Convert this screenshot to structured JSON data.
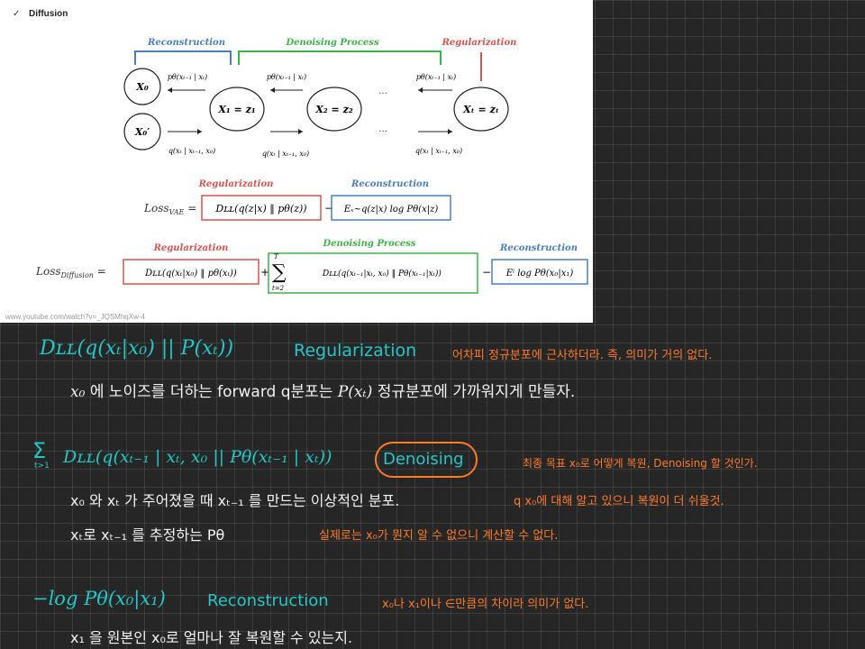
{
  "slide": {
    "header": "Diffusion",
    "check": "✓",
    "url": "www.youtube.com/watch?v=_JQSMhqXw-4",
    "labels": {
      "reconstruction": "Reconstruction",
      "denoising_process": "Denoising Process",
      "regularization": "Regularization"
    },
    "nodes": {
      "x0": "X₀",
      "x0_prime": "X₀′",
      "x1": "X₁ = z₁",
      "x2": "X₂ = z₂",
      "xT": "Xₜ = zₜ"
    },
    "arrows": {
      "p_x0": "pθ(xₜ₋₁ | xₜ)",
      "p_x1": "pθ(xₜ₋₁ | xₜ)",
      "p_xT": "pθ(xₜ₋₁ | xₜ)",
      "q_x0": "q(xₜ | xₜ₋₁, x₀)",
      "q_x1": "q(xₜ | xₜ₋₁, x₀)",
      "q_xT": "q(xₜ | xₜ₋₁, x₀)",
      "dots": "…"
    },
    "vae": {
      "loss": "Loss",
      "loss_sub": "VAE",
      "reg_label": "Regularization",
      "rec_label": "Reconstruction",
      "reg_term": "Dʟʟ(q(z|x) ‖ pθ(z))",
      "rec_term": "Eₓ~q(z|x) log Pθ(x|z)"
    },
    "diff": {
      "loss": "Loss",
      "loss_sub": "Diffusion",
      "reg_label": "Regularization",
      "den_label": "Denoising Process",
      "rec_label": "Reconstruction",
      "reg_term": "Dʟʟ(q(xₜ|x₀) ‖ pθ(xₜ))",
      "sum_top": "T",
      "sum_bottom": "t=2",
      "den_term": "Dʟʟ(q(xₜ₋₁|xₜ, x₀) ‖ Pθ(xₜ₋₁|xₜ))",
      "rec_term": "Eⁱ log Pθ(x₀|x₁)"
    }
  },
  "notes": {
    "line1": {
      "formula": "Dʟʟ(q(xₜ|x₀) || P(xₜ))",
      "tag": "Regularization",
      "comment": "어차피 정규분포에 근사하더라. 즉, 의미가 거의 없다."
    },
    "line2": {
      "var": "x₀",
      "text_a": "에 노이즈를 더하는 forward q분포는",
      "formula": "P(xₜ)",
      "text_b": "정규분포에 가까워지게 만들자."
    },
    "line3": {
      "sum": "Σ",
      "sum_sub": "t>1",
      "formula": "Dʟʟ(q(xₜ₋₁ | xₜ, x₀ || Pθ(xₜ₋₁ | xₜ))",
      "tag": "Denoising",
      "comment": "최종 목표 x₀로 어떻게 복원, Denoising 할 것인가."
    },
    "line4": {
      "text": "x₀ 와 xₜ 가 주어졌을 때 xₜ₋₁ 를 만드는 이상적인 분포.",
      "comment": "q x₀에 대해 알고 있으니 복원이 더 쉬울것."
    },
    "line5": {
      "text": "xₜ로 xₜ₋₁ 를 추정하는 Pθ",
      "comment": "실제로는 x₀가 뭔지 알 수 없으니 계산할 수 없다."
    },
    "line6": {
      "formula": "−log Pθ(x₀|x₁)",
      "tag": "Reconstruction",
      "comment": "x₀나 x₁이나 ∈만큼의 차이라 의미가 없다."
    },
    "line7": {
      "text": "x₁ 을 원본인 x₀로 얼마나 잘 복원할 수 있는지."
    }
  },
  "colors": {
    "background": "#262626",
    "handwriting_white": "#f2f2f2",
    "handwriting_teal": "#22c7c7",
    "handwriting_orange": "#ff7a2a",
    "slide_blue": "#4a7fc1",
    "slide_green": "#3fb24a",
    "slide_red": "#d9534f"
  }
}
